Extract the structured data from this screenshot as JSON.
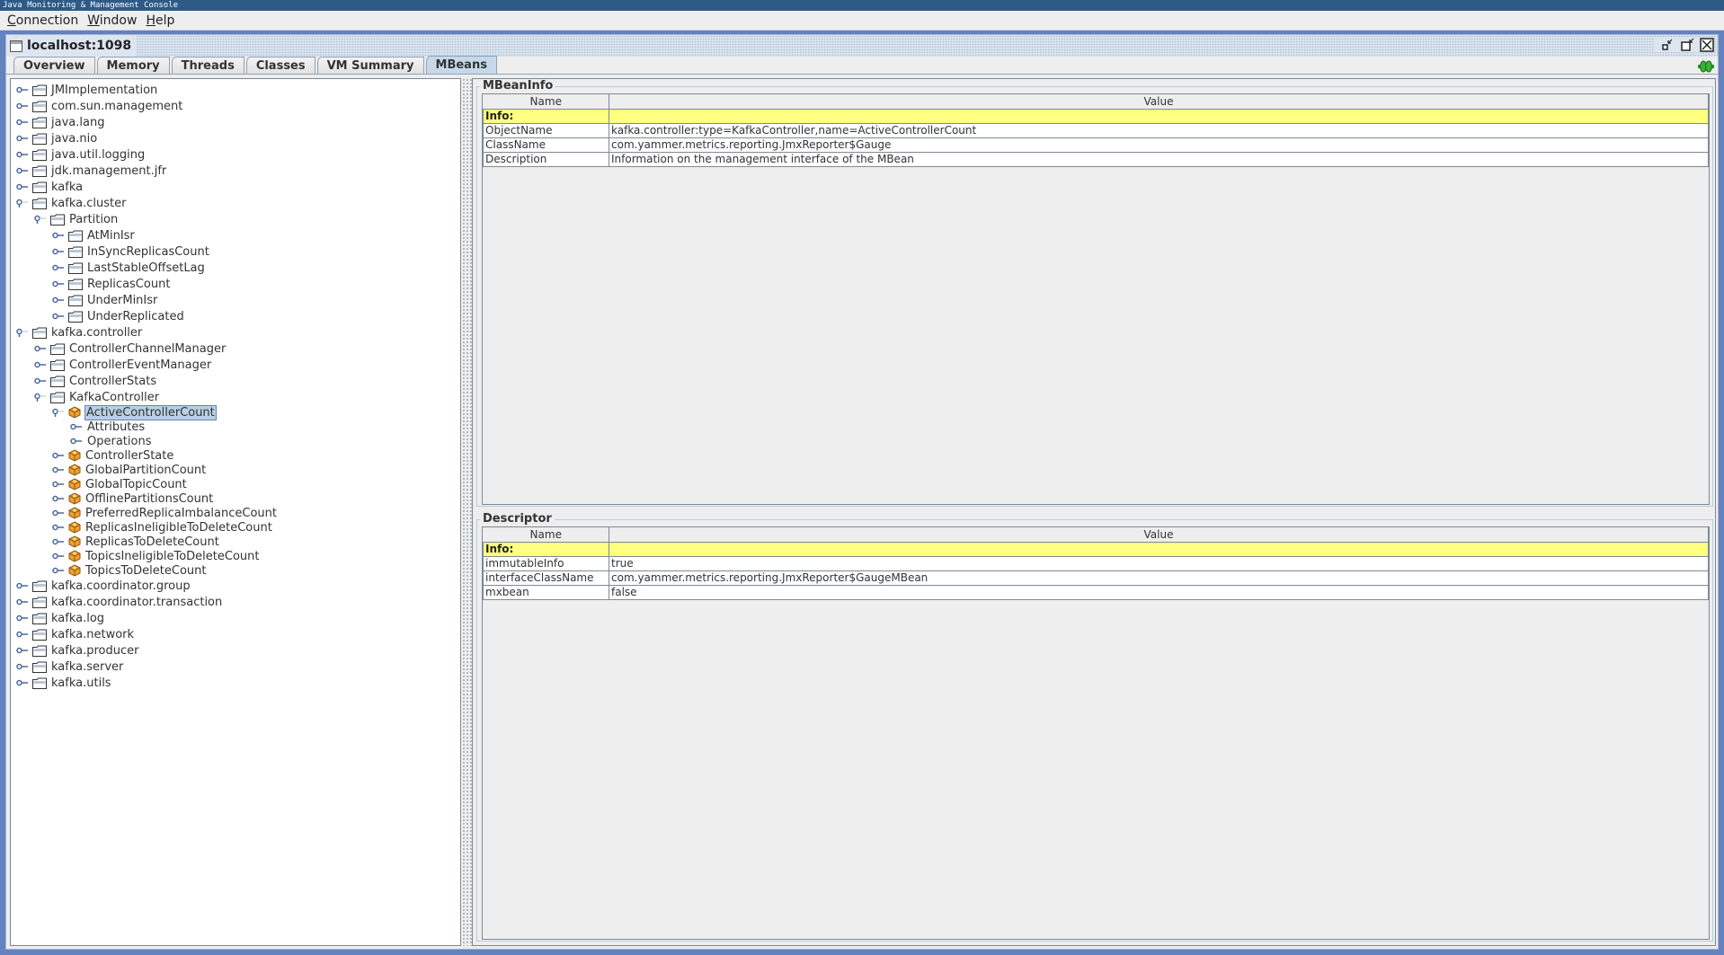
{
  "window": {
    "title": "Java Monitoring & Management Console"
  },
  "menu": [
    {
      "label": "Connection",
      "mnemonic": "C",
      "rest": "onnection"
    },
    {
      "label": "Window",
      "mnemonic": "W",
      "rest": "indow"
    },
    {
      "label": "Help",
      "mnemonic": "H",
      "rest": "elp"
    }
  ],
  "frame": {
    "title": "localhost:1098"
  },
  "tabs": [
    {
      "label": "Overview",
      "active": false
    },
    {
      "label": "Memory",
      "active": false
    },
    {
      "label": "Threads",
      "active": false
    },
    {
      "label": "Classes",
      "active": false
    },
    {
      "label": "VM Summary",
      "active": false
    },
    {
      "label": "MBeans",
      "active": true
    }
  ],
  "tree": [
    {
      "label": "JMImplementation",
      "depth": 0,
      "icon": "folder",
      "expanded": false
    },
    {
      "label": "com.sun.management",
      "depth": 0,
      "icon": "folder",
      "expanded": false
    },
    {
      "label": "java.lang",
      "depth": 0,
      "icon": "folder",
      "expanded": false
    },
    {
      "label": "java.nio",
      "depth": 0,
      "icon": "folder",
      "expanded": false
    },
    {
      "label": "java.util.logging",
      "depth": 0,
      "icon": "folder",
      "expanded": false
    },
    {
      "label": "jdk.management.jfr",
      "depth": 0,
      "icon": "folder",
      "expanded": false
    },
    {
      "label": "kafka",
      "depth": 0,
      "icon": "folder",
      "expanded": false
    },
    {
      "label": "kafka.cluster",
      "depth": 0,
      "icon": "folder",
      "expanded": true
    },
    {
      "label": "Partition",
      "depth": 1,
      "icon": "folder",
      "expanded": true
    },
    {
      "label": "AtMinIsr",
      "depth": 2,
      "icon": "folder",
      "expanded": false
    },
    {
      "label": "InSyncReplicasCount",
      "depth": 2,
      "icon": "folder",
      "expanded": false
    },
    {
      "label": "LastStableOffsetLag",
      "depth": 2,
      "icon": "folder",
      "expanded": false
    },
    {
      "label": "ReplicasCount",
      "depth": 2,
      "icon": "folder",
      "expanded": false
    },
    {
      "label": "UnderMinIsr",
      "depth": 2,
      "icon": "folder",
      "expanded": false
    },
    {
      "label": "UnderReplicated",
      "depth": 2,
      "icon": "folder",
      "expanded": false
    },
    {
      "label": "kafka.controller",
      "depth": 0,
      "icon": "folder",
      "expanded": true
    },
    {
      "label": "ControllerChannelManager",
      "depth": 1,
      "icon": "folder",
      "expanded": false
    },
    {
      "label": "ControllerEventManager",
      "depth": 1,
      "icon": "folder",
      "expanded": false
    },
    {
      "label": "ControllerStats",
      "depth": 1,
      "icon": "folder",
      "expanded": false
    },
    {
      "label": "KafkaController",
      "depth": 1,
      "icon": "folder",
      "expanded": true
    },
    {
      "label": "ActiveControllerCount",
      "depth": 2,
      "icon": "bean",
      "expanded": true,
      "selected": true
    },
    {
      "label": "Attributes",
      "depth": 3,
      "icon": "none",
      "expanded": false
    },
    {
      "label": "Operations",
      "depth": 3,
      "icon": "none",
      "expanded": false
    },
    {
      "label": "ControllerState",
      "depth": 2,
      "icon": "bean",
      "expanded": false
    },
    {
      "label": "GlobalPartitionCount",
      "depth": 2,
      "icon": "bean",
      "expanded": false
    },
    {
      "label": "GlobalTopicCount",
      "depth": 2,
      "icon": "bean",
      "expanded": false
    },
    {
      "label": "OfflinePartitionsCount",
      "depth": 2,
      "icon": "bean",
      "expanded": false
    },
    {
      "label": "PreferredReplicaImbalanceCount",
      "depth": 2,
      "icon": "bean",
      "expanded": false
    },
    {
      "label": "ReplicasIneligibleToDeleteCount",
      "depth": 2,
      "icon": "bean",
      "expanded": false
    },
    {
      "label": "ReplicasToDeleteCount",
      "depth": 2,
      "icon": "bean",
      "expanded": false
    },
    {
      "label": "TopicsIneligibleToDeleteCount",
      "depth": 2,
      "icon": "bean",
      "expanded": false
    },
    {
      "label": "TopicsToDeleteCount",
      "depth": 2,
      "icon": "bean",
      "expanded": false
    },
    {
      "label": "kafka.coordinator.group",
      "depth": 0,
      "icon": "folder",
      "expanded": false
    },
    {
      "label": "kafka.coordinator.transaction",
      "depth": 0,
      "icon": "folder",
      "expanded": false
    },
    {
      "label": "kafka.log",
      "depth": 0,
      "icon": "folder",
      "expanded": false
    },
    {
      "label": "kafka.network",
      "depth": 0,
      "icon": "folder",
      "expanded": false
    },
    {
      "label": "kafka.producer",
      "depth": 0,
      "icon": "folder",
      "expanded": false
    },
    {
      "label": "kafka.server",
      "depth": 0,
      "icon": "folder",
      "expanded": false
    },
    {
      "label": "kafka.utils",
      "depth": 0,
      "icon": "folder",
      "expanded": false
    }
  ],
  "mbean_info": {
    "title": "MBeanInfo",
    "columns": [
      "Name",
      "Value"
    ],
    "info_label": "Info:",
    "rows": [
      {
        "name": "ObjectName",
        "value": "kafka.controller:type=KafkaController,name=ActiveControllerCount"
      },
      {
        "name": "ClassName",
        "value": "com.yammer.metrics.reporting.JmxReporter$Gauge"
      },
      {
        "name": "Description",
        "value": "Information on the management interface of the MBean"
      }
    ]
  },
  "descriptor": {
    "title": "Descriptor",
    "columns": [
      "Name",
      "Value"
    ],
    "info_label": "Info:",
    "rows": [
      {
        "name": "immutableInfo",
        "value": "true"
      },
      {
        "name": "interfaceClassName",
        "value": "com.yammer.metrics.reporting.JmxReporter$GaugeMBean"
      },
      {
        "name": "mxbean",
        "value": "false"
      }
    ]
  },
  "colors": {
    "accent": "#6382bf",
    "info_row": "#ffff80",
    "selected": "#b8cfe5",
    "bean_icon": "#f0a030"
  }
}
